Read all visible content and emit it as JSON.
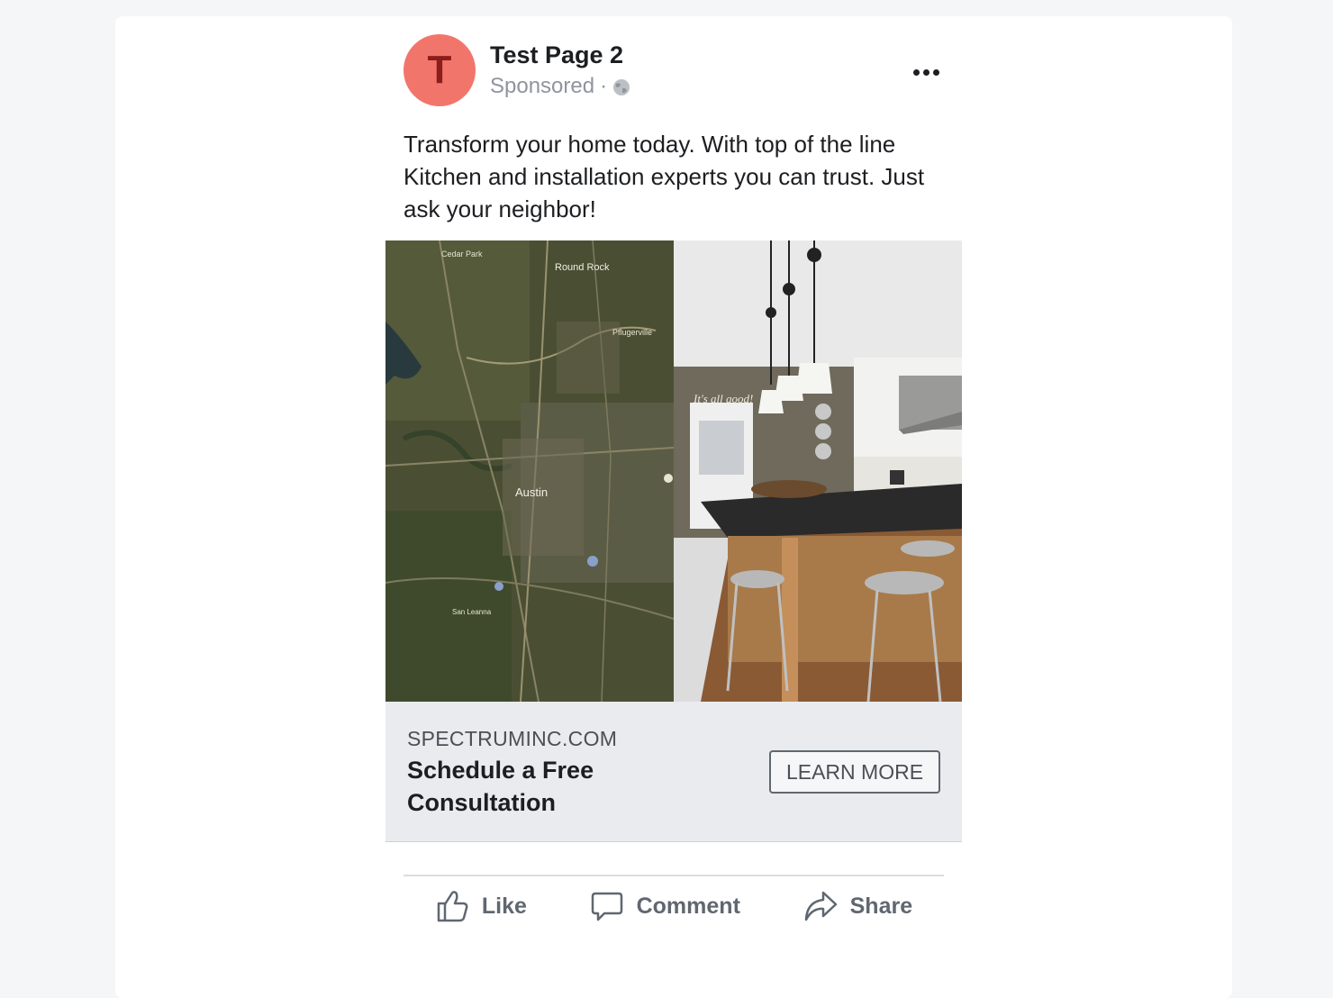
{
  "post": {
    "page_name": "Test Page 2",
    "avatar_letter": "T",
    "sponsored_label": "Sponsored",
    "separator": "·",
    "body_text": "Transform your home today. With top of the line Kitchen and installation experts you can trust. Just ask your neighbor!",
    "icons": [
      "globe-icon",
      "more-options-icon",
      "like-icon",
      "comment-icon",
      "share-icon"
    ]
  },
  "media": {
    "map_labels": {
      "cedar_park": "Cedar Park",
      "round_rock": "Round Rock",
      "pflugerville": "Pflugerville",
      "austin": "Austin",
      "san_leanna": "San Leanna"
    },
    "kitchen_sign": "It's all good!"
  },
  "link": {
    "domain": "SPECTRUMINC.COM",
    "headline": "Schedule a Free Consultation",
    "cta_label": "LEARN MORE"
  },
  "actions": {
    "like": "Like",
    "comment": "Comment",
    "share": "Share"
  },
  "colors": {
    "avatar_bg": "#f2756b",
    "avatar_letter": "#8b1e1c",
    "link_bg": "#e9ebee",
    "meta_text": "#90949c"
  }
}
